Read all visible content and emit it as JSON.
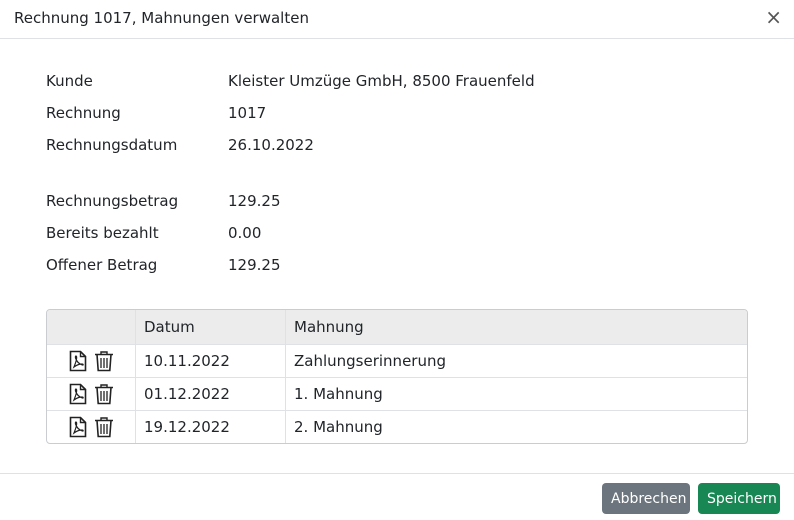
{
  "dialog": {
    "title": "Rechnung 1017, Mahnungen verwalten",
    "close_symbol": "×"
  },
  "info": {
    "customer_label": "Kunde",
    "customer_value": "Kleister Umzüge GmbH, 8500 Frauenfeld",
    "invoice_label": "Rechnung",
    "invoice_value": "1017",
    "invoice_date_label": "Rechnungsdatum",
    "invoice_date_value": "26.10.2022",
    "amount_label": "Rechnungsbetrag",
    "amount_value": "129.25",
    "paid_label": "Bereits bezahlt",
    "paid_value": "0.00",
    "open_label": "Offener Betrag",
    "open_value": "129.25"
  },
  "table": {
    "headers": {
      "date": "Datum",
      "reminder": "Mahnung"
    },
    "rows": [
      {
        "date": "10.11.2022",
        "reminder": "Zahlungserinnerung"
      },
      {
        "date": "01.12.2022",
        "reminder": "1. Mahnung"
      },
      {
        "date": "19.12.2022",
        "reminder": "2. Mahnung"
      }
    ],
    "row_icons": [
      "pdf-icon",
      "trash-icon"
    ]
  },
  "footer": {
    "cancel_label": "Abbrechen",
    "save_label": "Speichern"
  },
  "colors": {
    "cancel": "#6c757d",
    "save": "#198754",
    "table_header": "#ececec"
  }
}
